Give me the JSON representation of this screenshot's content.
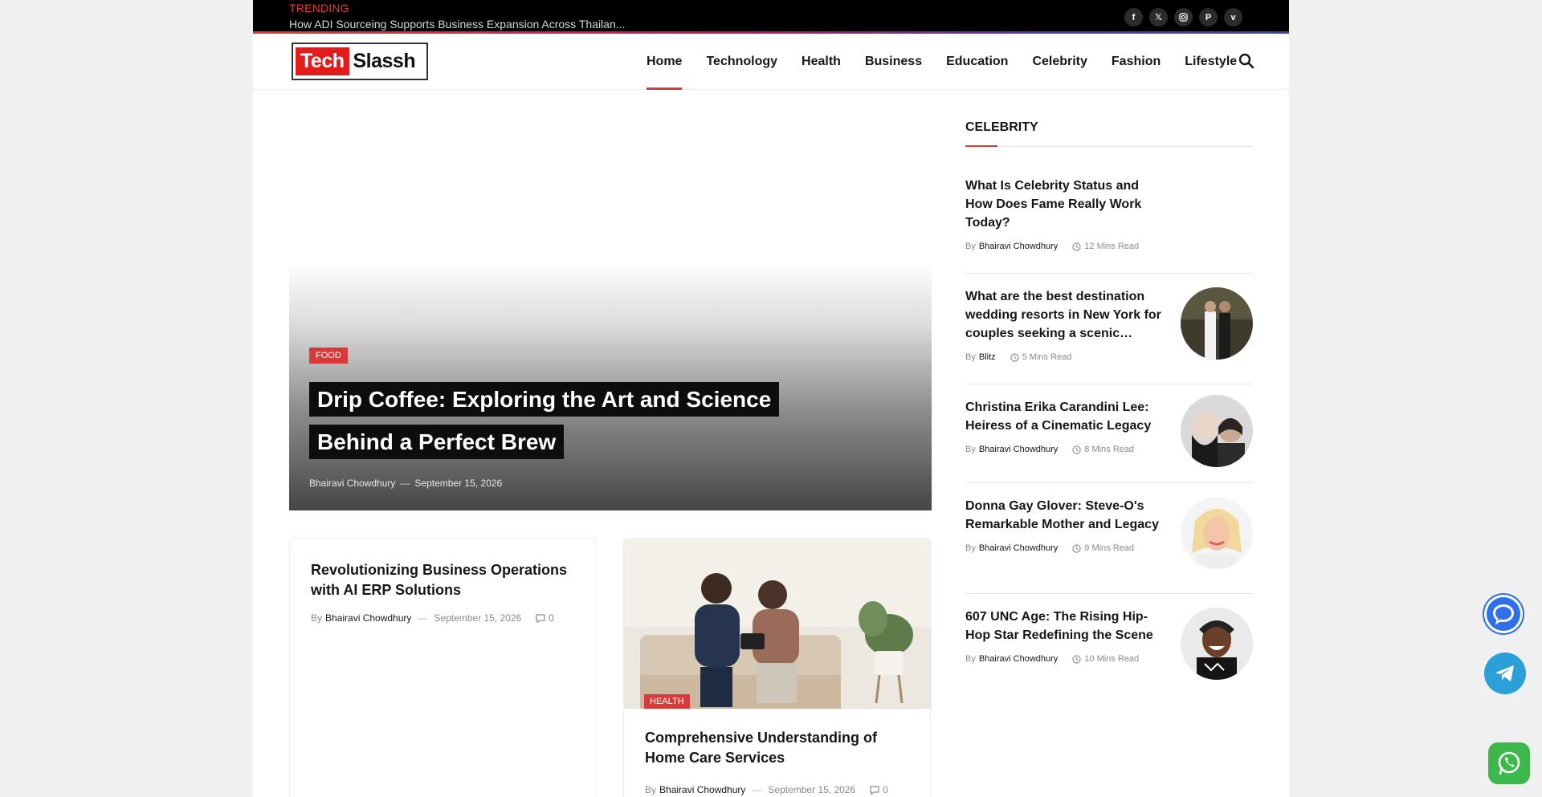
{
  "topbar": {
    "trending_label": "TRENDING",
    "trending_text": "How ADI Sourceing Supports Business Expansion Across Thailan...",
    "socials": [
      "facebook-icon",
      "x-icon",
      "instagram-icon",
      "pinterest-icon",
      "vimeo-icon"
    ]
  },
  "header": {
    "logo_red": "Tech",
    "logo_black": "Slassh",
    "nav": [
      "Home",
      "Technology",
      "Health",
      "Business",
      "Education",
      "Celebrity",
      "Fashion",
      "Lifestyle"
    ],
    "active_nav": "Home"
  },
  "hero": {
    "category": "FOOD",
    "title": "Drip Coffee: Exploring the Art and Science Behind a Perfect Brew",
    "author": "Bhairavi Chowdhury",
    "separator": "—",
    "date": "September 15, 2026"
  },
  "cards": [
    {
      "title": "Revolutionizing Business Operations with AI ERP Solutions",
      "by": "By",
      "author": "Bhairavi Chowdhury",
      "separator": "—",
      "date": "September 15, 2026",
      "comments": "0"
    },
    {
      "category": "HEALTH",
      "title": "Comprehensive Understanding of Home Care Services",
      "by": "By",
      "author": "Bhairavi Chowdhury",
      "separator": "—",
      "date": "September 15, 2026",
      "comments": "0"
    }
  ],
  "sidebar": {
    "heading": "CELEBRITY",
    "items": [
      {
        "title": "What Is Celebrity Status and How Does Fame Really Work Today?",
        "by": "By",
        "author": "Bhairavi Chowdhury",
        "read": "12 Mins Read"
      },
      {
        "title": "What are the best destination wedding resorts in New York for couples seeking a scenic…",
        "by": "By",
        "author": "Blitz",
        "read": "5 Mins Read"
      },
      {
        "title": "Christina Erika Carandini Lee: Heiress of a Cinematic Legacy",
        "by": "By",
        "author": "Bhairavi Chowdhury",
        "read": "8 Mins Read"
      },
      {
        "title": "Donna Gay Glover: Steve-O's Remarkable Mother and Legacy",
        "by": "By",
        "author": "Bhairavi Chowdhury",
        "read": "9 Mins Read"
      },
      {
        "title": "607 UNC Age: The Rising Hip-Hop Star Redefining the Scene",
        "by": "By",
        "author": "Bhairavi Chowdhury",
        "read": "10 Mins Read"
      }
    ]
  },
  "colors": {
    "accent": "#d83a3a",
    "topbar_bg": "#000000",
    "chat_fab": "#2f6fea",
    "telegram_fab": "#2a9fd8",
    "whatsapp_fab": "#3db84a"
  }
}
